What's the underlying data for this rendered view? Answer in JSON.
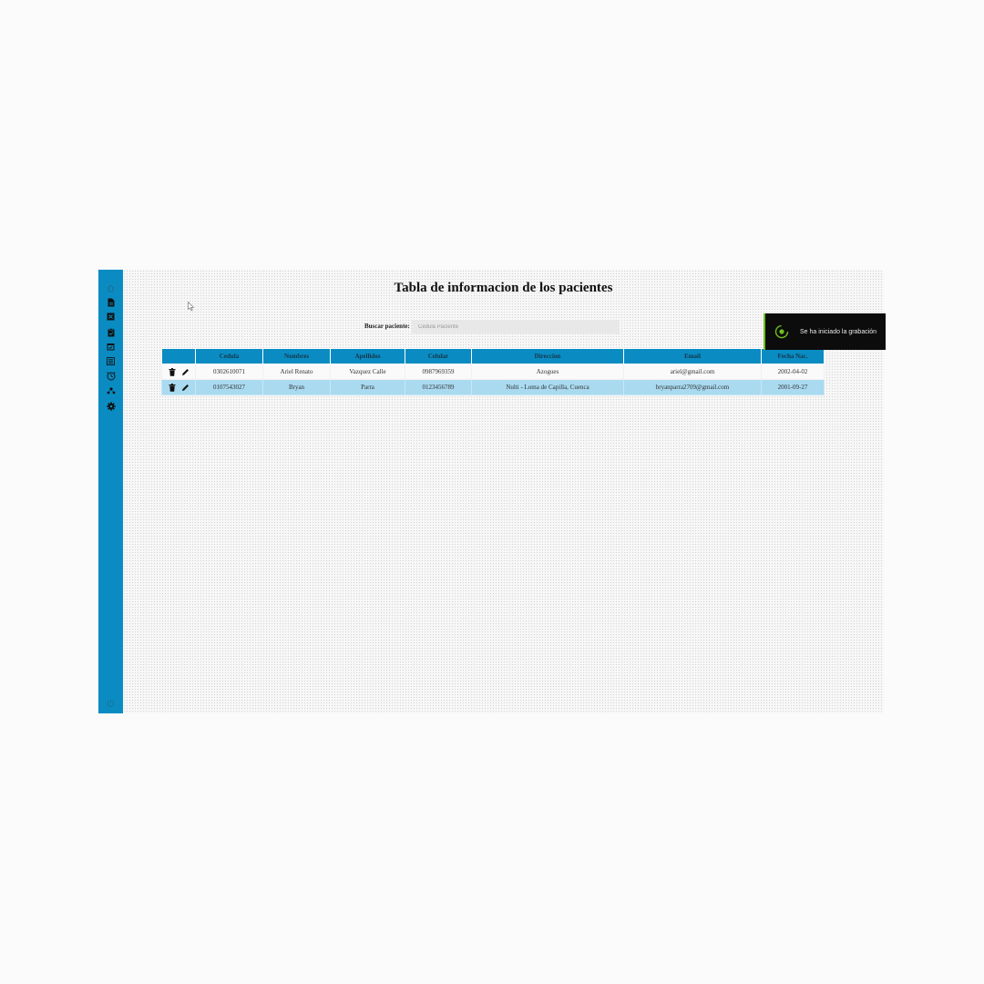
{
  "page": {
    "title": "Tabla de informacion de los pacientes"
  },
  "sidebar": {
    "items": [
      {
        "icon": "home-icon"
      },
      {
        "icon": "file-icon"
      },
      {
        "icon": "crossed-box-icon"
      },
      {
        "icon": "clipboard-icon"
      },
      {
        "icon": "calendar-check-icon"
      },
      {
        "icon": "list-icon"
      },
      {
        "icon": "user-clock-icon"
      },
      {
        "icon": "users-icon"
      },
      {
        "icon": "gear-icon"
      }
    ],
    "footer_icon": "power-icon",
    "color": "#0a8cc2"
  },
  "search": {
    "label": "Buscar paciente:",
    "placeholder": "Cedula Paciente",
    "value": ""
  },
  "table": {
    "columns": [
      "",
      "Cedula",
      "Nombres",
      "Apellidos",
      "Celular",
      "Direccion",
      "Email",
      "Fecha Nac."
    ],
    "rows": [
      {
        "cedula": "0302610071",
        "nombres": "Ariel Renato",
        "apellidos": "Vazquez Calle",
        "celular": "0987969359",
        "direccion": "Azogues",
        "email": "ariel@gmail.com",
        "fecha": "2002-04-02"
      },
      {
        "cedula": "0107543027",
        "nombres": "Bryan",
        "apellidos": "Parra",
        "celular": "0123456789",
        "direccion": "Nulti - Loma de Capilla, Cuenca",
        "email": "bryanparra2709@gmail.com",
        "fecha": "2001-09-27"
      }
    ],
    "row_actions": [
      "trash-icon",
      "pencil-icon"
    ],
    "header_color": "#0a8cc2",
    "alt_row_color": "#a9daf0"
  },
  "toast": {
    "text": "Se ha iniciado la grabación",
    "icon": "recording-icon",
    "accent": "#6fbf1e"
  }
}
